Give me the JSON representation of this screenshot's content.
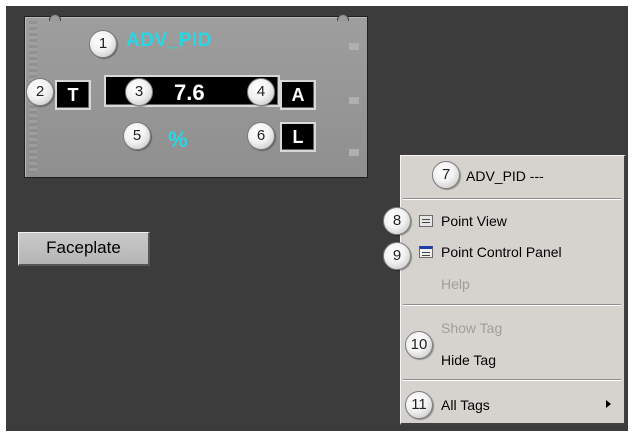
{
  "tile": {
    "title": "ADV_PID",
    "tag_button": "T",
    "value": "7.6",
    "mode_button": "A",
    "unit": "%",
    "limit_button": "L",
    "title_color": "#24d8e6"
  },
  "faceplate_button": "Faceplate",
  "context_menu": {
    "title": "ADV_PID ---",
    "items": {
      "point_view": "Point View",
      "point_control_panel": "Point Control Panel",
      "help": "Help",
      "show_tag": "Show Tag",
      "hide_tag": "Hide Tag",
      "all_tags": "All Tags"
    }
  },
  "callouts": [
    "1",
    "2",
    "3",
    "4",
    "5",
    "6",
    "7",
    "8",
    "9",
    "10",
    "11"
  ]
}
